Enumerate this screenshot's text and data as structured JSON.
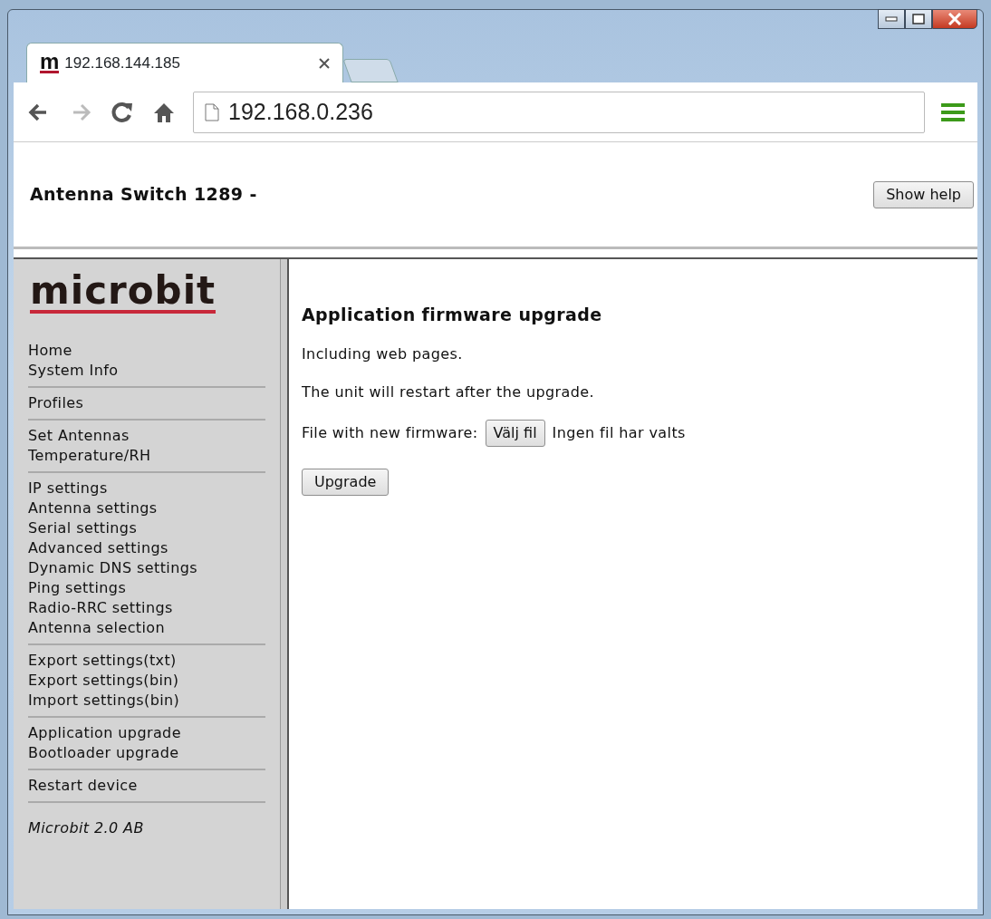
{
  "browser": {
    "tabs": [
      {
        "favicon": "m",
        "title": "192.168.144.185",
        "selected": true
      }
    ],
    "nav_buttons": [
      {
        "kind": "back",
        "disabled": false
      },
      {
        "kind": "forward",
        "disabled": true
      },
      {
        "kind": "reload",
        "disabled": false
      },
      {
        "kind": "home",
        "disabled": false
      }
    ],
    "address": "192.168.0.236"
  },
  "header": {
    "title": "Antenna Switch 1289 -",
    "help_button": "Show help"
  },
  "sidebar": {
    "logo": "microbit",
    "groups": [
      {
        "items": [
          "Home",
          "System Info"
        ]
      },
      {
        "items": [
          "Profiles"
        ]
      },
      {
        "items": [
          "Set Antennas",
          "Temperature/RH"
        ]
      },
      {
        "items": [
          "IP settings",
          "Antenna settings",
          "Serial settings",
          "Advanced settings",
          "Dynamic DNS settings",
          "Ping settings",
          "Radio-RRC settings",
          "Antenna selection"
        ]
      },
      {
        "items": [
          "Export settings(txt)",
          "Export settings(bin)",
          "Import settings(bin)"
        ]
      },
      {
        "items": [
          "Application upgrade",
          "Bootloader upgrade"
        ]
      },
      {
        "items": [
          "Restart device"
        ]
      }
    ],
    "footer": "Microbit 2.0 AB"
  },
  "main": {
    "heading": "Application firmware upgrade",
    "paragraphs": [
      "Including web pages.",
      "The unit will restart after the upgrade."
    ],
    "file_label": "File with new firmware:",
    "choose_button": "Välj fil",
    "file_status": "Ingen fil har valts",
    "submit_button": "Upgrade"
  }
}
